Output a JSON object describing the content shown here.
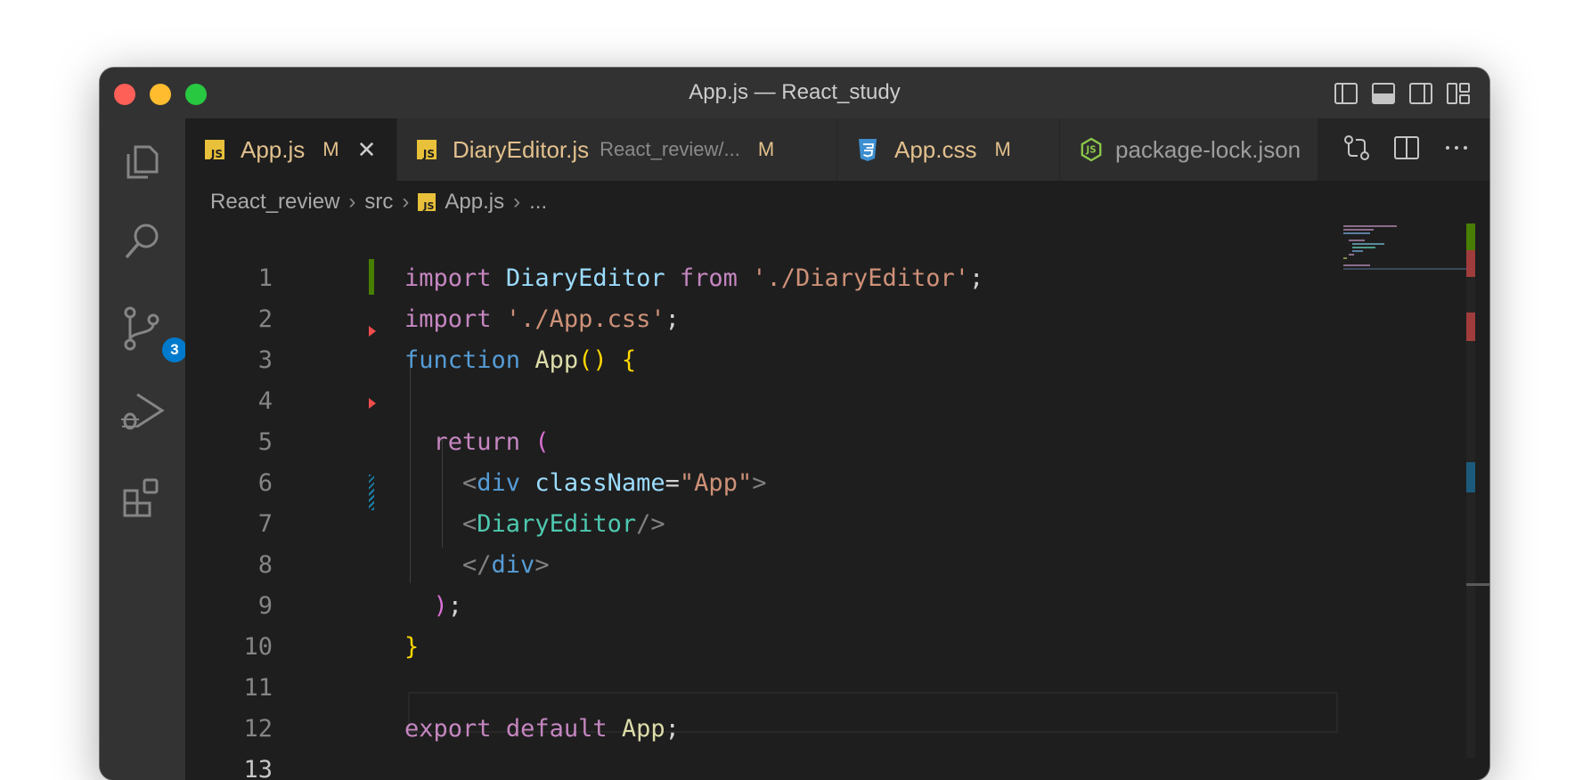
{
  "window": {
    "title": "App.js — React_study"
  },
  "activity_bar": {
    "items": [
      "explorer",
      "search",
      "source-control",
      "run-and-debug",
      "extensions"
    ],
    "scm_badge": "3"
  },
  "tabs": [
    {
      "name": "App.js",
      "status": "M",
      "close": "✕",
      "icon": "js-icon",
      "active": true
    },
    {
      "name": "DiaryEditor.js",
      "path": "React_review/...",
      "status": "M",
      "icon": "js-icon"
    },
    {
      "name": "App.css",
      "status": "M",
      "icon": "css-icon"
    },
    {
      "name": "package-lock.json",
      "icon": "node-json-icon"
    }
  ],
  "breadcrumb": [
    "React_review",
    "src",
    "App.js",
    "..."
  ],
  "editor": {
    "line_numbers": [
      "1",
      "2",
      "3",
      "4",
      "5",
      "6",
      "7",
      "8",
      "9",
      "10",
      "11",
      "12",
      "13"
    ],
    "current_line": "13"
  },
  "colors": {
    "keyword": "#c586c0",
    "string": "#ce9178",
    "variable": "#9cdcfe",
    "function": "#dcdcaa",
    "storage": "#569cd6",
    "tag_component": "#4ec9b0",
    "git_added": "#487e02",
    "git_modified": "#1b81a8",
    "git_deleted": "#f14c4c"
  }
}
